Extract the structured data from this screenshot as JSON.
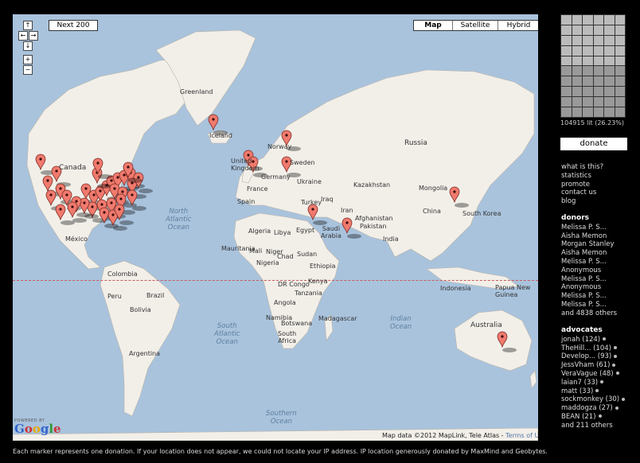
{
  "map": {
    "next_label": "Next 200",
    "maptypes": [
      "Map",
      "Satellite",
      "Hybrid"
    ],
    "controls": [
      "↑",
      "←",
      "→",
      "↓",
      "+",
      "−"
    ],
    "labels": {
      "greenland": "Greenland",
      "iceland": "Iceland",
      "canada": "Canada",
      "united_kingdom": "United\nKingdom",
      "norway": "Norway",
      "sweden": "Sweden",
      "germany": "Germany",
      "france": "France",
      "spain": "Spain",
      "ukraine": "Ukraine",
      "kazakhstan": "Kazakhstan",
      "russia": "Russia",
      "mongolia": "Mongolia",
      "china": "China",
      "south_korea": "South Korea",
      "turkey": "Turkey",
      "iraq": "Iraq",
      "iran": "Iran",
      "afghanistan": "Afghanistan",
      "pakistan": "Pakistan",
      "india": "India",
      "egypt": "Egypt",
      "saudi_arabia": "Saudi\nArabia",
      "algeria": "Algeria",
      "libya": "Libya",
      "mauritania": "Mauritania",
      "mali": "Mali",
      "niger": "Niger",
      "chad": "Chad",
      "sudan": "Sudan",
      "ethiopia": "Ethiopia",
      "nigeria": "Nigeria",
      "kenya": "Kenya",
      "dr_congo": "DR Congo",
      "tanzania": "Tanzania",
      "angola": "Angola",
      "namibia": "Namibia",
      "botswana": "Botswana",
      "south_africa": "South\nAfrica",
      "madagascar": "Madagascar",
      "mexico": "México",
      "colombia": "Colombia",
      "peru": "Peru",
      "brazil": "Brazil",
      "bolivia": "Bolivia",
      "argentina": "Argentina",
      "indonesia": "Indonesia",
      "papua": "Papua New\nGuinea",
      "australia": "Australia",
      "north_atlantic": "North\nAtlantic\nOcean",
      "south_atlantic": "South\nAtlantic\nOcean",
      "indian_ocean": "Indian\nOcean",
      "southern_ocean": "Southern\nOcean"
    },
    "powered_by": "POWERED BY",
    "logo": "Google",
    "attribution": "Map data ©2012 MapLink, Tele Atlas - ",
    "terms": "Terms of Use"
  },
  "footer": "Each marker represents one donation. If your location does not appear, we could not locate your IP address. IP location generously donated by MaxMind and Geobytes.",
  "sidebar": {
    "lit_text": "104915 lit (26.23%)",
    "donate_label": "donate",
    "links": [
      "what is this?",
      "statistics",
      "promote",
      "contact us",
      "blog"
    ],
    "donors_heading": "donors",
    "donors": [
      "Melissa P. S...",
      "Aisha Memon",
      "Morgan Stanley",
      "Aisha Memon",
      "Melissa P. S...",
      "Anonymous",
      "Melissa P. S...",
      "Anonymous",
      "Melissa P. S...",
      "Melissa P. S..."
    ],
    "donors_more": "and 4838 others",
    "advocates_heading": "advocates",
    "advocates": [
      "jonah (124)",
      "TheHill... (104)",
      "Develop... (93)",
      "JessVham (61)",
      "VeraVague (48)",
      "laian7 (33)",
      "matt (33)",
      "sockmonkey (30)",
      "maddogza (27)",
      "BEAN (21)"
    ],
    "advocates_more": "and 211 others"
  }
}
